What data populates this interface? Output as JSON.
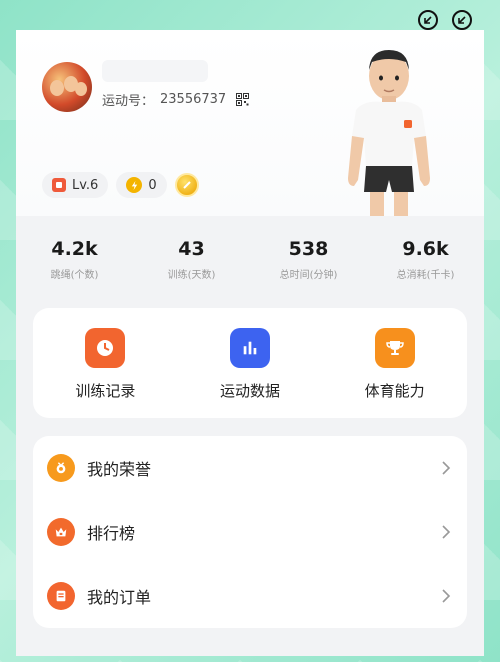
{
  "profile": {
    "sport_id_label": "运动号：",
    "sport_id": "23556737",
    "level": "Lv.6",
    "points": "0"
  },
  "stats": [
    {
      "value": "4.2k",
      "label": "跳绳(个数)"
    },
    {
      "value": "43",
      "label": "训练(天数)"
    },
    {
      "value": "538",
      "label": "总时间(分钟)"
    },
    {
      "value": "9.6k",
      "label": "总消耗(千卡)"
    }
  ],
  "quick_actions": [
    {
      "label": "训练记录",
      "icon": "clock-icon",
      "color": "#f2652f"
    },
    {
      "label": "运动数据",
      "icon": "bar-chart-icon",
      "color": "#3d63f0"
    },
    {
      "label": "体育能力",
      "icon": "trophy-icon",
      "color": "#f7901d"
    }
  ],
  "menu": [
    {
      "label": "我的荣誉",
      "icon": "medal-icon",
      "color": "#f79a1d"
    },
    {
      "label": "排行榜",
      "icon": "crown-icon",
      "color": "#f26a2c"
    },
    {
      "label": "我的订单",
      "icon": "order-icon",
      "color": "#f2652f"
    }
  ],
  "colors": {
    "background": "#a6ead2",
    "card": "#f2f3f5",
    "level_badge": "#ef5a3b",
    "bolt": "#f4b400"
  }
}
